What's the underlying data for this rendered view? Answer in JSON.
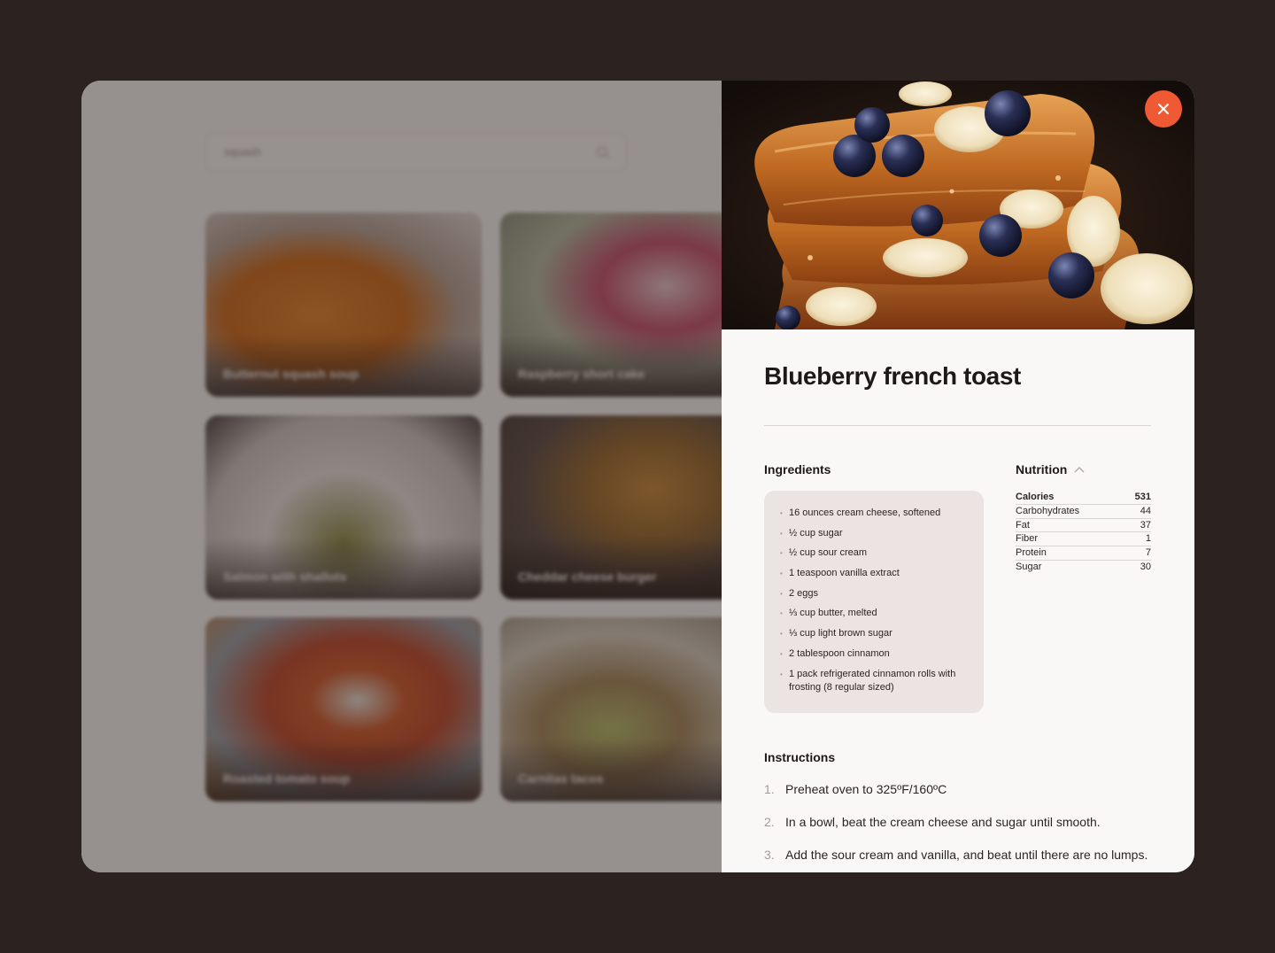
{
  "search": {
    "value": "squash"
  },
  "recipes": [
    {
      "title": "Butternut squash soup"
    },
    {
      "title": "Raspberry short cake"
    },
    {
      "title": "Salmon with shallots"
    },
    {
      "title": "Cheddar cheese burger"
    },
    {
      "title": "Roasted tomato soup"
    },
    {
      "title": "Carnitas tacos"
    }
  ],
  "detail": {
    "close_icon": "close-icon",
    "title": "Blueberry french toast",
    "ingredients_heading": "Ingredients",
    "ingredients": [
      "16 ounces cream cheese, softened",
      "½ cup sugar",
      "½ cup sour cream",
      "1 teaspoon vanilla extract",
      "2 eggs",
      "⅓ cup butter, melted",
      "⅓ cup light brown sugar",
      "2 tablespoon cinnamon",
      "1 pack refrigerated cinnamon rolls with frosting (8 regular sized)"
    ],
    "nutrition_heading": "Nutrition",
    "nutrition": [
      {
        "label": "Calories",
        "value": "531"
      },
      {
        "label": "Carbohydrates",
        "value": "44"
      },
      {
        "label": "Fat",
        "value": "37"
      },
      {
        "label": "Fiber",
        "value": "1"
      },
      {
        "label": "Protein",
        "value": "7"
      },
      {
        "label": "Sugar",
        "value": "30"
      }
    ],
    "instructions_heading": "Instructions",
    "instructions": [
      {
        "num": "1.",
        "text": "Preheat oven to 325ºF/160ºC"
      },
      {
        "num": "2.",
        "text": "In a bowl, beat the cream cheese and sugar until smooth."
      },
      {
        "num": "3.",
        "text": "Add the sour cream and vanilla, and beat until there are no lumps."
      }
    ]
  },
  "colors": {
    "background": "#2c2220",
    "accent": "#ef5a35",
    "panel": "#faf8f6",
    "ingredients_box": "#ebe4e2"
  }
}
